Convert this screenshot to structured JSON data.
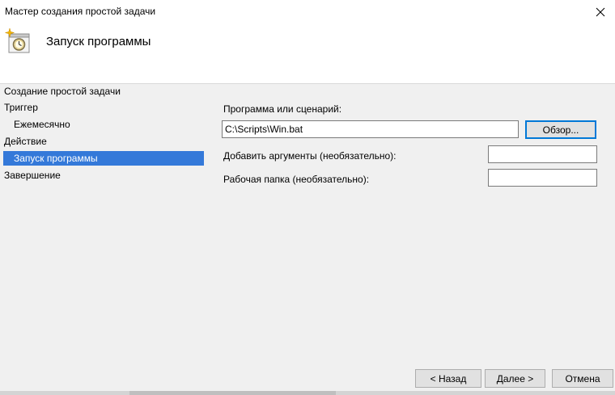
{
  "window": {
    "title": "Мастер создания простой задачи"
  },
  "header": {
    "heading": "Запуск программы"
  },
  "nav": {
    "items": [
      {
        "label": "Создание простой задачи"
      },
      {
        "label": "Триггер"
      },
      {
        "label": "Ежемесячно"
      },
      {
        "label": "Действие"
      },
      {
        "label": "Запуск программы"
      },
      {
        "label": "Завершение"
      }
    ]
  },
  "form": {
    "program_label": "Программа или сценарий:",
    "program_value": "C:\\Scripts\\Win.bat",
    "browse_label": "Обзор...",
    "args_label": "Добавить аргументы (необязательно):",
    "args_value": "",
    "workdir_label": "Рабочая папка (необязательно):",
    "workdir_value": ""
  },
  "footer": {
    "back_label": "< Назад",
    "next_label": "Далее >",
    "cancel_label": "Отмена"
  },
  "colors": {
    "selection": "#3479d9",
    "header_bg": "#ffffff",
    "window_bg": "#f0f0f0"
  },
  "icons": {
    "close": "close-icon",
    "wizard": "scheduled-task-wizard-icon"
  }
}
